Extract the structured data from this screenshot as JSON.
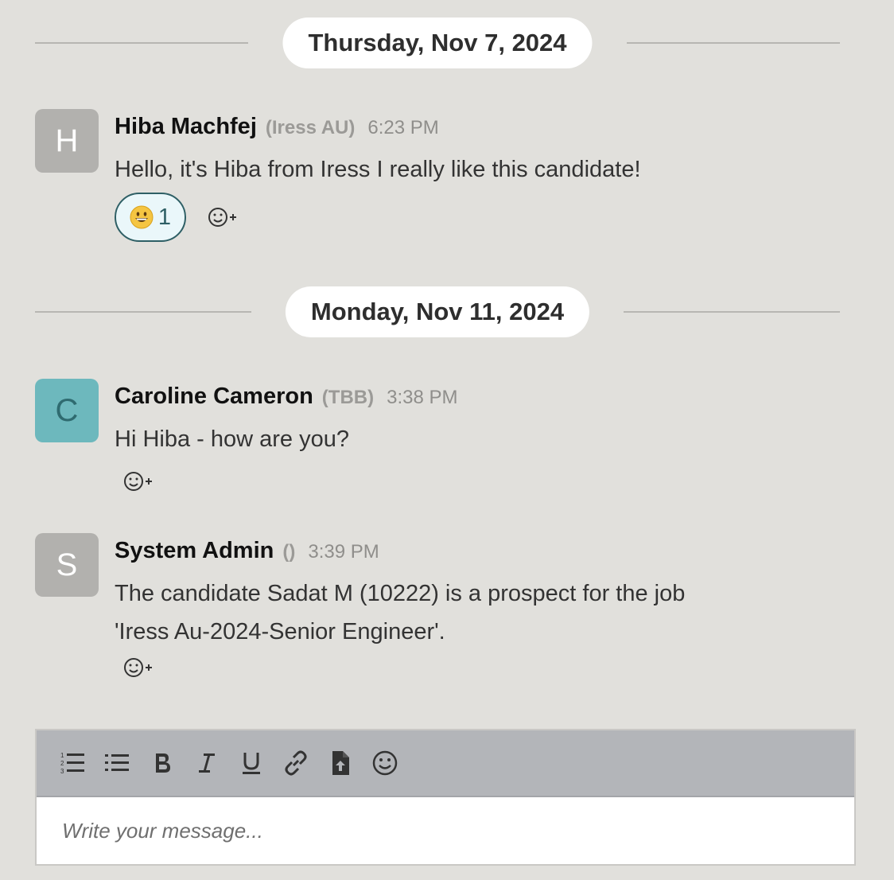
{
  "dates": [
    {
      "label": "Thursday, Nov 7, 2024"
    },
    {
      "label": "Monday, Nov 11, 2024"
    }
  ],
  "messages": [
    {
      "initial": "H",
      "name": "Hiba Machfej",
      "org": "(Iress AU)",
      "time": "6:23 PM",
      "text": [
        "Hello, it's Hiba from Iress I really like this candidate!"
      ],
      "reaction": {
        "emoji": "grinning-face",
        "count": "1"
      }
    },
    {
      "initial": "C",
      "name": "Caroline Cameron",
      "org": "(TBB)",
      "time": "3:38 PM",
      "text": [
        "Hi Hiba - how are you?"
      ]
    },
    {
      "initial": "S",
      "name": "System Admin",
      "org": "()",
      "time": "3:39 PM",
      "text": [
        "The candidate Sadat M (10222) is a prospect for the job",
        "'Iress Au-2024-Senior Engineer'."
      ]
    }
  ],
  "composer": {
    "placeholder": "Write your message...",
    "toolbar": [
      "ordered-list-icon",
      "bullet-list-icon",
      "bold-icon",
      "italic-icon",
      "underline-icon",
      "link-icon",
      "file-upload-icon",
      "emoji-icon"
    ]
  },
  "colors": {
    "background": "#e1e0dc",
    "avatar_gray": "#b2b1ae",
    "avatar_teal": "#6db8bd",
    "reaction_border": "#2e5f65",
    "toolbar": "#b3b5b9"
  }
}
